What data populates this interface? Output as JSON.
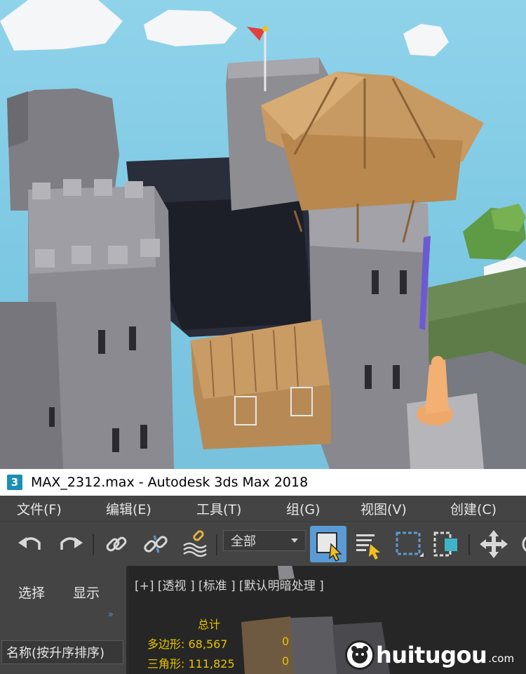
{
  "window": {
    "app_icon_label": "3",
    "title": "MAX_2312.max - Autodesk 3ds Max 2018"
  },
  "menu": {
    "items": [
      {
        "label": "文件(F)"
      },
      {
        "label": "编辑(E)"
      },
      {
        "label": "工具(T)"
      },
      {
        "label": "组(G)"
      },
      {
        "label": "视图(V)"
      },
      {
        "label": "创建(C)"
      }
    ]
  },
  "toolbar": {
    "icons": [
      "undo-icon",
      "redo-icon",
      "link-icon",
      "unlink-icon",
      "bind-spacewarp-icon",
      "select-object-icon",
      "select-by-name-icon",
      "rectangular-selection-region-icon",
      "window-crossing-icon",
      "move-icon"
    ],
    "selection_filter": "全部",
    "accent_color": "#5b9bd5"
  },
  "scene_explorer": {
    "tabs": [
      {
        "label": "选择"
      },
      {
        "label": "显示"
      }
    ],
    "expand_glyph": "»",
    "column_header": "名称(按升序排序)"
  },
  "viewport": {
    "label": "[+] [透视 ] [标准 ] [默认明暗处理 ]",
    "stats": {
      "title": "总计",
      "polygons_label": "多边形:",
      "polygons_value": "68,567",
      "polygons_selected": "0",
      "triangles_label": "三角形:",
      "triangles_value": "111,825",
      "triangles_selected": "0"
    }
  },
  "watermark": {
    "brand": "huitugou",
    "suffix": ".com"
  }
}
